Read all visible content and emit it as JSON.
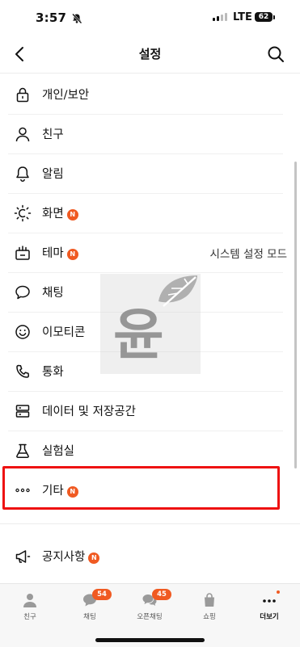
{
  "status_bar": {
    "time": "3:57",
    "network": "LTE",
    "battery": "62"
  },
  "header": {
    "title": "설정"
  },
  "menu": {
    "items": [
      {
        "icon": "lock-icon",
        "label": "개인/보안",
        "badge": "",
        "value": ""
      },
      {
        "icon": "person-icon",
        "label": "친구",
        "badge": "",
        "value": ""
      },
      {
        "icon": "bell-icon",
        "label": "알림",
        "badge": "",
        "value": ""
      },
      {
        "icon": "brightness-icon",
        "label": "화면",
        "badge": "N",
        "value": ""
      },
      {
        "icon": "theme-icon",
        "label": "테마",
        "badge": "N",
        "value": "시스템 설정 모드"
      },
      {
        "icon": "chat-bubble-icon",
        "label": "채팅",
        "badge": "",
        "value": ""
      },
      {
        "icon": "smiley-icon",
        "label": "이모티콘",
        "badge": "",
        "value": ""
      },
      {
        "icon": "phone-icon",
        "label": "통화",
        "badge": "",
        "value": ""
      },
      {
        "icon": "storage-icon",
        "label": "데이터 및 저장공간",
        "badge": "",
        "value": ""
      },
      {
        "icon": "flask-icon",
        "label": "실험실",
        "badge": "",
        "value": ""
      },
      {
        "icon": "more-dots-icon",
        "label": "기타",
        "badge": "N",
        "value": ""
      }
    ],
    "notice": {
      "icon": "megaphone-icon",
      "label": "공지사항",
      "badge": "N"
    }
  },
  "watermark": {
    "text": "윤"
  },
  "tabbar": {
    "tabs": [
      {
        "label": "친구",
        "badge": ""
      },
      {
        "label": "채팅",
        "badge": "54"
      },
      {
        "label": "오픈채팅",
        "badge": "45"
      },
      {
        "label": "쇼핑",
        "badge": ""
      },
      {
        "label": "더보기",
        "badge": ""
      }
    ]
  },
  "colors": {
    "badge": "#f05a22",
    "highlight": "#ee1212"
  }
}
